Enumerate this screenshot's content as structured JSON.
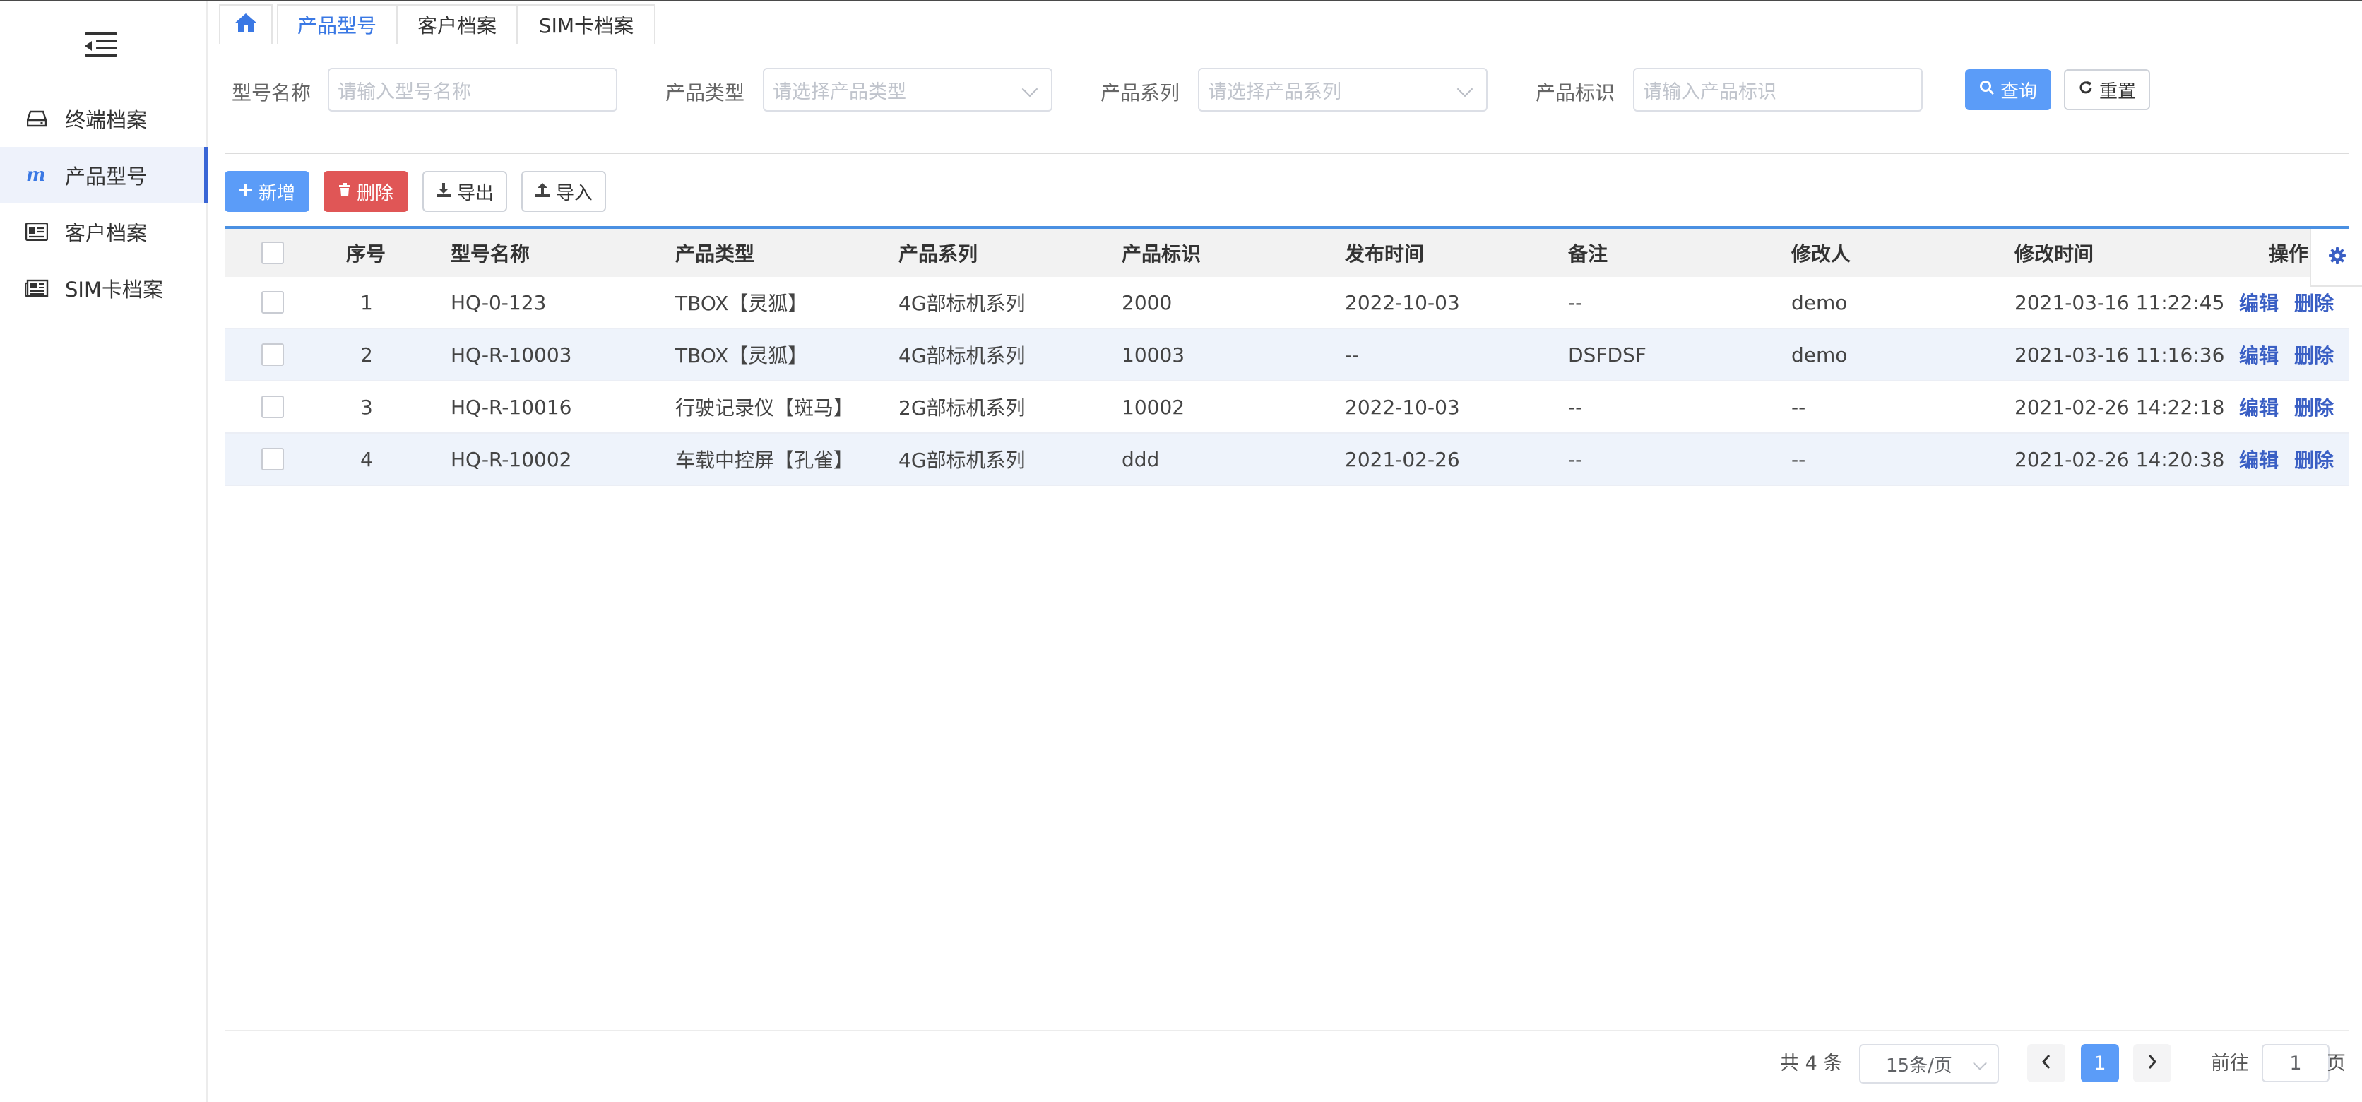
{
  "sidebar": {
    "items": [
      {
        "label": "终端档案",
        "icon": "hard-drive-icon"
      },
      {
        "label": "产品型号",
        "icon": "m-logo-icon",
        "active": true
      },
      {
        "label": "客户档案",
        "icon": "id-card-icon"
      },
      {
        "label": "SIM卡档案",
        "icon": "newspaper-icon"
      }
    ]
  },
  "tabs": [
    {
      "label": "产品型号",
      "active": true
    },
    {
      "label": "客户档案"
    },
    {
      "label": "SIM卡档案"
    }
  ],
  "search": {
    "model_name_label": "型号名称",
    "model_name_placeholder": "请输入型号名称",
    "product_type_label": "产品类型",
    "product_type_placeholder": "请选择产品类型",
    "product_series_label": "产品系列",
    "product_series_placeholder": "请选择产品系列",
    "product_id_label": "产品标识",
    "product_id_placeholder": "请输入产品标识",
    "query_label": "查询",
    "reset_label": "重置"
  },
  "toolbar": {
    "add_label": "新增",
    "delete_label": "删除",
    "export_label": "导出",
    "import_label": "导入"
  },
  "table": {
    "headers": [
      "序号",
      "型号名称",
      "产品类型",
      "产品系列",
      "产品标识",
      "发布时间",
      "备注",
      "修改人",
      "修改时间",
      "操作"
    ],
    "rows": [
      {
        "index": "1",
        "name": "HQ-0-123",
        "type": "TBOX【灵狐】",
        "series": "4G部标机系列",
        "pid": "2000",
        "release": "2022-10-03",
        "remark": "--",
        "modifier": "demo",
        "mtime": "2021-03-16 11:22:45"
      },
      {
        "index": "2",
        "name": "HQ-R-10003",
        "type": "TBOX【灵狐】",
        "series": "4G部标机系列",
        "pid": "10003",
        "release": "--",
        "remark": "DSFDSF",
        "modifier": "demo",
        "mtime": "2021-03-16 11:16:36"
      },
      {
        "index": "3",
        "name": "HQ-R-10016",
        "type": "行驶记录仪【斑马】",
        "series": "2G部标机系列",
        "pid": "10002",
        "release": "2022-10-03",
        "remark": "--",
        "modifier": "--",
        "mtime": "2021-02-26 14:22:18"
      },
      {
        "index": "4",
        "name": "HQ-R-10002",
        "type": "车载中控屏【孔雀】",
        "series": "4G部标机系列",
        "pid": "ddd",
        "release": "2021-02-26",
        "remark": "--",
        "modifier": "--",
        "mtime": "2021-02-26 14:20:38"
      }
    ],
    "edit_label": "编辑",
    "delete_label": "删除"
  },
  "pagination": {
    "total": "共 4 条",
    "page_size": "15条/页",
    "current_page": "1",
    "goto_prefix": "前往",
    "goto_value": "1",
    "goto_suffix": "页"
  },
  "colors": {
    "primary": "#5b9cf8",
    "danger": "#e05656",
    "link": "#3a5fc4",
    "active_indicator": "#3a66d6"
  }
}
